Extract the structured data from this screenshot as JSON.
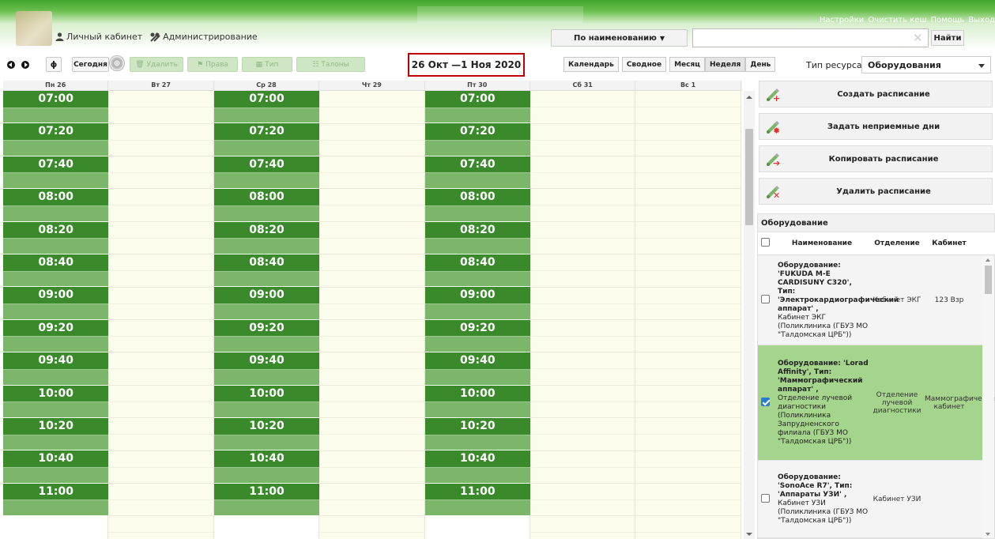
{
  "header": {
    "links": [
      "Настройки",
      "Очистить кеш",
      "Помощь",
      "Выход"
    ],
    "nav": [
      {
        "icon": "user-icon",
        "label": "Личный кабинет"
      },
      {
        "icon": "tools-icon",
        "label": "Администрирование"
      }
    ],
    "sort_label": "По наименованию",
    "search_value": "",
    "search_placeholder": "",
    "find_label": "Найти"
  },
  "toolbar": {
    "today_label": "Сегодня",
    "delete_label": "Удалить",
    "rights_label": "Права",
    "type_label": "Тип",
    "tickets_label": "Талоны",
    "date_range": "26 Окт —1 Ноя 2020",
    "view_calendar": "Календарь",
    "view_summary": "Сводное",
    "view_month": "Месяц",
    "view_week": "Неделя",
    "view_day": "День",
    "resource_type_label": "Тип ресурса:",
    "resource_type_value": "Оборудования"
  },
  "calendar": {
    "days": [
      "Пн 26",
      "Вт 27",
      "Ср 28",
      "Чт 29",
      "Пт 30",
      "Сб 31",
      "Вс 1"
    ],
    "working_days": [
      0,
      2,
      4
    ],
    "times": [
      "07:00",
      "07:20",
      "07:40",
      "08:00",
      "08:20",
      "08:40",
      "09:00",
      "09:20",
      "09:40",
      "10:00",
      "10:20",
      "10:40",
      "11:00"
    ]
  },
  "actions": [
    {
      "label": "Создать расписание",
      "badge": "plus"
    },
    {
      "label": "Задать неприемные дни",
      "badge": "star"
    },
    {
      "label": "Копировать расписание",
      "badge": "arrow"
    },
    {
      "label": "Удалить расписание",
      "badge": "cross"
    }
  ],
  "equipment": {
    "title": "Оборудование",
    "columns": [
      "Наименование",
      "Отделение",
      "Кабинет"
    ],
    "rows": [
      {
        "name": "Оборудование: 'FUKUDA M-E CARDISUNY C320', Тип: 'Электрокардиографический аппарат' ,",
        "details": "Кабинет ЭКГ (Поликлиника (ГБУЗ МО \"Талдомская ЦРБ\"))",
        "department": "Кабинет ЭКГ",
        "room": "123 Взр",
        "checked": false
      },
      {
        "name": "Оборудование: 'Lorad Affinity', Тип: 'Маммографический аппарат' ,",
        "details": "Отделение лучевой диагностики (Поликлиника Запрудненского филиала (ГБУЗ МО \"Талдомская ЦРБ\"))",
        "department": "Отделение лучевой диагностики",
        "room": "Маммографический кабинет",
        "checked": true
      },
      {
        "name": "Оборудование: 'SonoAce R7', Тип: 'Аппараты УЗИ' ,",
        "details": "Кабинет УЗИ (Поликлиника (ГБУЗ МО \"Талдомская ЦРБ\"))",
        "department": "Кабинет УЗИ",
        "room": "",
        "checked": false
      }
    ]
  },
  "colors": {
    "slot_dark": "#3a8a2c",
    "slot_light": "#7cb66a",
    "selected_row": "#a5d58c",
    "highlight_border": "#c00000"
  }
}
